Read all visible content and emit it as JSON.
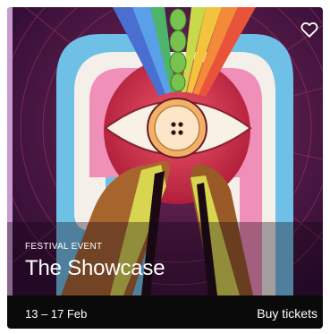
{
  "event": {
    "category": "FESTIVAL EVENT",
    "title": "The Showcase",
    "dates": "13 – 17 Feb"
  },
  "actions": {
    "buy_label": "Buy tickets",
    "favorite_icon": "heart-outline-icon"
  },
  "colors": {
    "footer_bg": "#0a0a0a",
    "art_bg": "#3a0f3d",
    "card_border": "#bf8fc2"
  }
}
